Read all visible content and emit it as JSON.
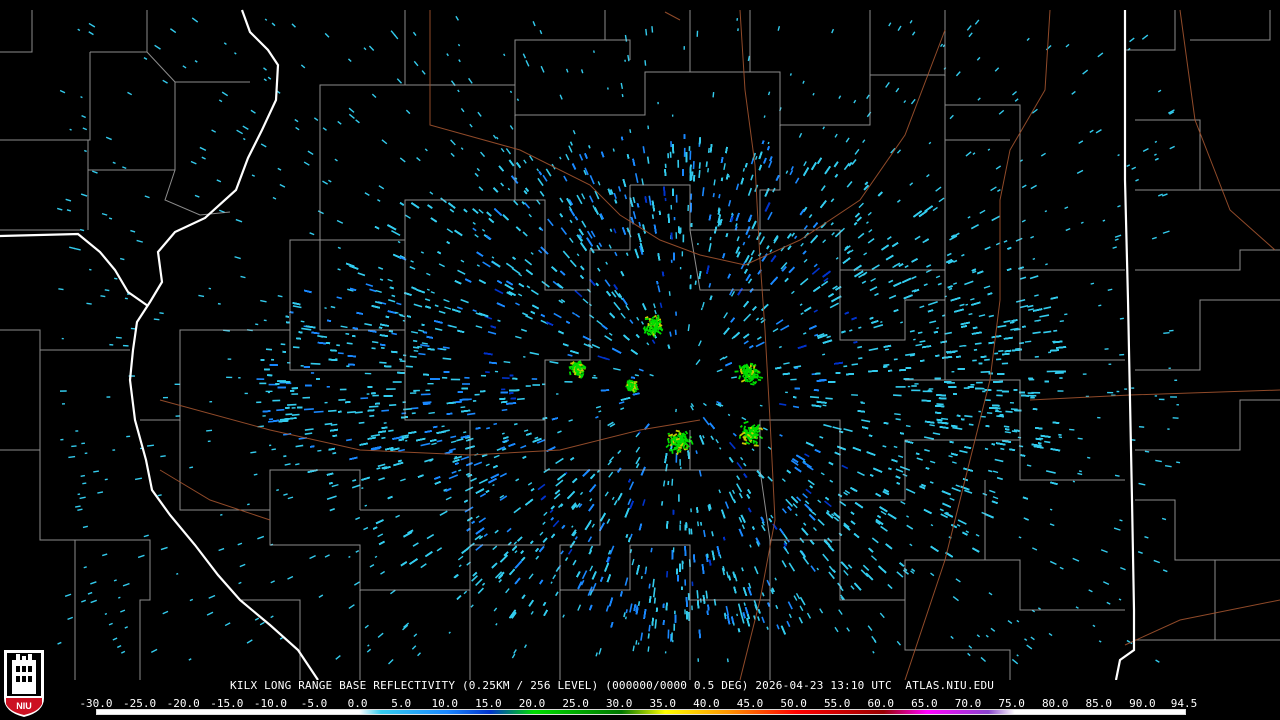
{
  "product": {
    "caption": "KILX LONG RANGE BASE REFLECTIVITY (0.25KM / 256 LEVEL) (000000/0000 0.5 DEG) 2026-04-23 13:10 UTC  ATLAS.NIU.EDU",
    "logo_text": "NIU"
  },
  "colorbar": {
    "labels": [
      "-30.0",
      "-25.0",
      "-20.0",
      "-15.0",
      "-10.0",
      "-5.0",
      "0.0",
      "5.0",
      "10.0",
      "15.0",
      "20.0",
      "25.0",
      "30.0",
      "35.0",
      "40.0",
      "45.0",
      "50.0",
      "55.0",
      "60.0",
      "65.0",
      "70.0",
      "75.0",
      "80.0",
      "85.0",
      "90.0",
      "94.5"
    ],
    "stops": [
      {
        "dbz": -30,
        "color": "#ffffff"
      },
      {
        "dbz": 0,
        "color": "#ffffff"
      },
      {
        "dbz": 2.5,
        "color": "#33ccee"
      },
      {
        "dbz": 10,
        "color": "#1a88ff"
      },
      {
        "dbz": 15,
        "color": "#0033cc"
      },
      {
        "dbz": 20,
        "color": "#00dd00"
      },
      {
        "dbz": 30,
        "color": "#007700"
      },
      {
        "dbz": 35,
        "color": "#ffff00"
      },
      {
        "dbz": 42,
        "color": "#ff9900"
      },
      {
        "dbz": 50,
        "color": "#ff0000"
      },
      {
        "dbz": 60,
        "color": "#990000"
      },
      {
        "dbz": 65,
        "color": "#ff00ff"
      },
      {
        "dbz": 72,
        "color": "#8844cc"
      },
      {
        "dbz": 75,
        "color": "#ffffff"
      },
      {
        "dbz": 94.5,
        "color": "#ffffff"
      }
    ]
  },
  "map_colors": {
    "background": "#000000",
    "county_lines": "#bbbbbb",
    "state_lines": "#ffffff",
    "highways": "#a0522d",
    "echo_light": "#33ccee",
    "echo_mid": "#1a88ff",
    "echo_dark": "#0033cc",
    "echo_green": "#00dd00",
    "echo_yellow": "#cccc00"
  }
}
